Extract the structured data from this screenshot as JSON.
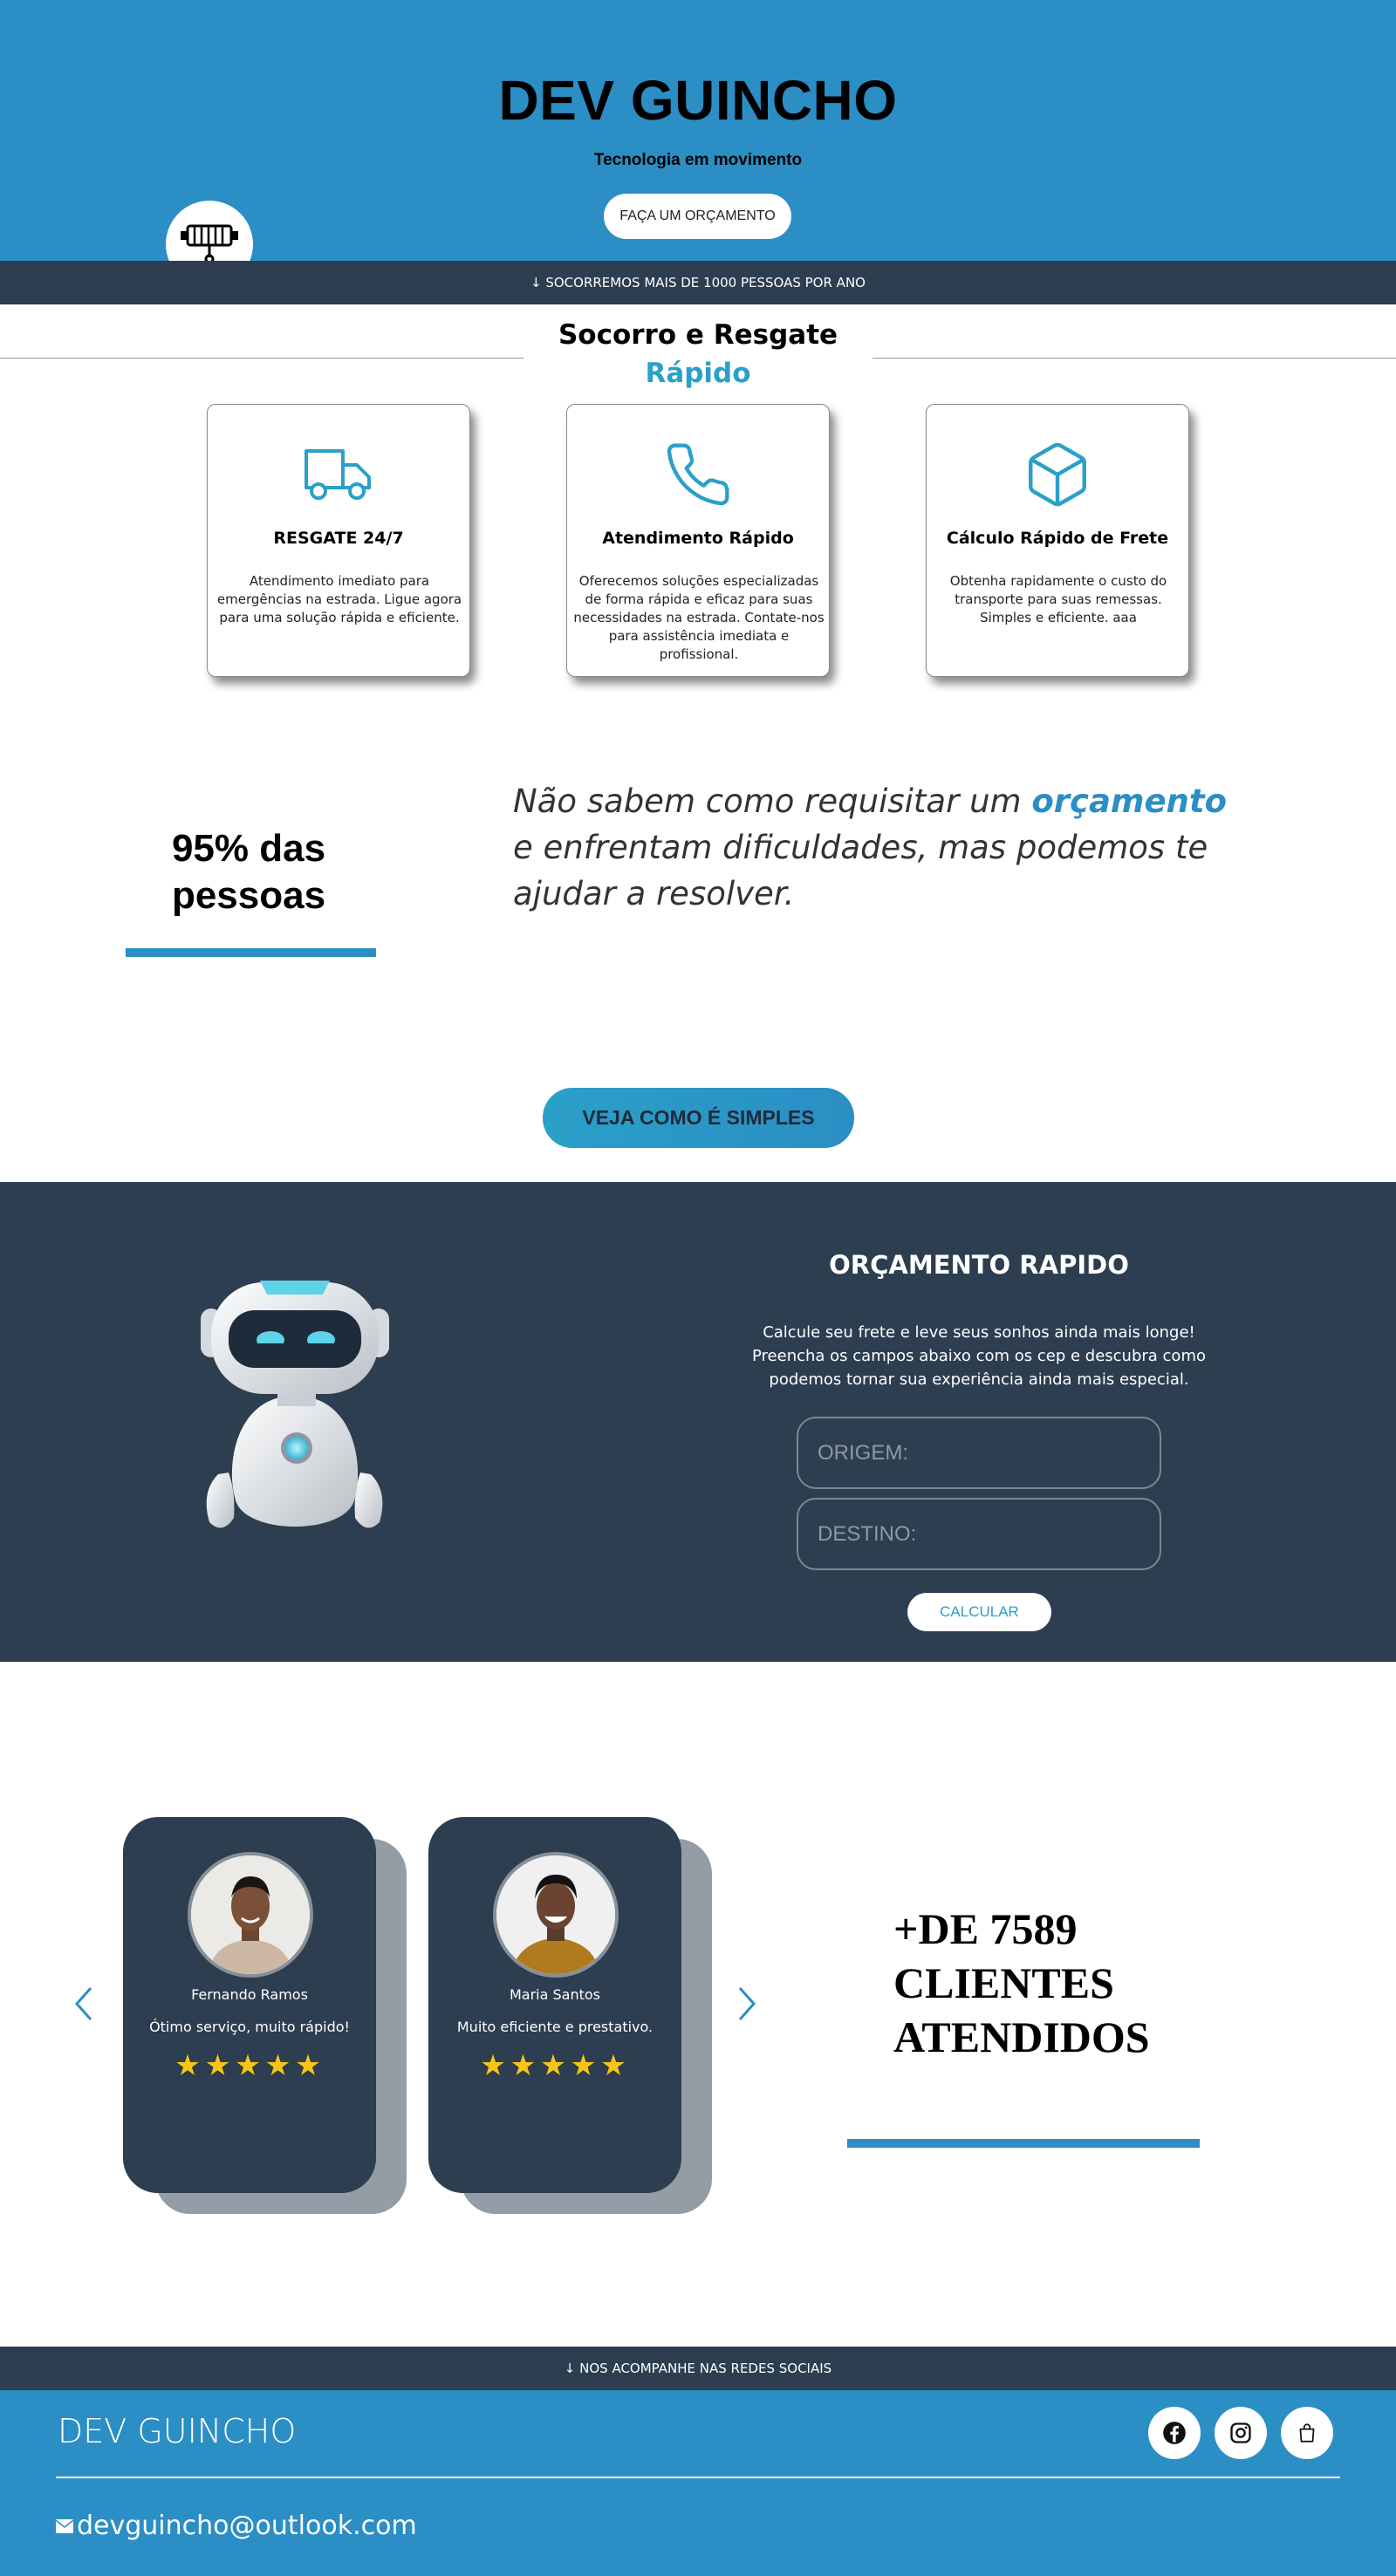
{
  "header": {
    "title": "DEV GUINCHO",
    "tagline": "Tecnologia em movimento",
    "quote_button": "FAÇA UM ORÇAMENTO"
  },
  "stats_bar": "↓ SOCORREMOS MAIS DE 1000 PESSOAS POR ANO",
  "section": {
    "title_main": "Socorro e Resgate",
    "title_accent": "Rápido"
  },
  "features": [
    {
      "icon": "truck-icon",
      "title": "RESGATE 24/7",
      "text": "Atendimento imediato para emergências na estrada. Ligue agora para uma solução rápida e eficiente."
    },
    {
      "icon": "phone-icon",
      "title": "Atendimento Rápido",
      "text": "Oferecemos soluções especializadas de forma rápida e eficaz para suas necessidades na estrada. Contate-nos para assistência imediata e profissional."
    },
    {
      "icon": "box-icon",
      "title": "Cálculo Rápido de Frete",
      "text": "Obtenha rapidamente o custo do transporte para suas remessas. Simples e eficiente. aaa"
    }
  ],
  "highlight": {
    "percent_text": "95% das pessoas",
    "quote_before": "Não sabem como requisitar um",
    "quote_accent": "orçamento",
    "quote_after": "e enfrentam dificuldades, mas podemos te ajudar a resolver."
  },
  "how_button": "VEJA COMO É SIMPLES",
  "quote_form": {
    "title": "ORÇAMENTO RAPIDO",
    "description": "Calcule seu frete e leve seus sonhos ainda mais longe! Preencha os campos abaixo com os cep e descubra como podemos tornar sua experiência ainda mais especial.",
    "origin_placeholder": "ORIGEM:",
    "destination_placeholder": "DESTINO:",
    "calculate_button": "CALCULAR"
  },
  "testimonials": [
    {
      "name": "Fernando Ramos",
      "text": "Ótimo serviço, muito rápido!",
      "rating": 5,
      "stars": "★★★★★"
    },
    {
      "name": "Maria Santos",
      "text": "Muito eficiente e prestativo.",
      "rating": 5,
      "stars": "★★★★★"
    }
  ],
  "clients": {
    "line1": "+DE 7589",
    "line2": "CLIENTES",
    "line3": "ATENDIDOS"
  },
  "social_bar": "↓ NOS ACOMPANHE NAS REDES SOCIAIS",
  "footer": {
    "brand": "DEV GUINCHO",
    "email": "devguincho@outlook.com",
    "social_icons": [
      "facebook-icon",
      "instagram-icon",
      "shopping-bag-icon"
    ]
  },
  "colors": {
    "primary_blue": "#2b8ec4",
    "accent_teal": "#2aa0c8",
    "dark_navy": "#2c3e50",
    "star_yellow": "#f5c518"
  }
}
